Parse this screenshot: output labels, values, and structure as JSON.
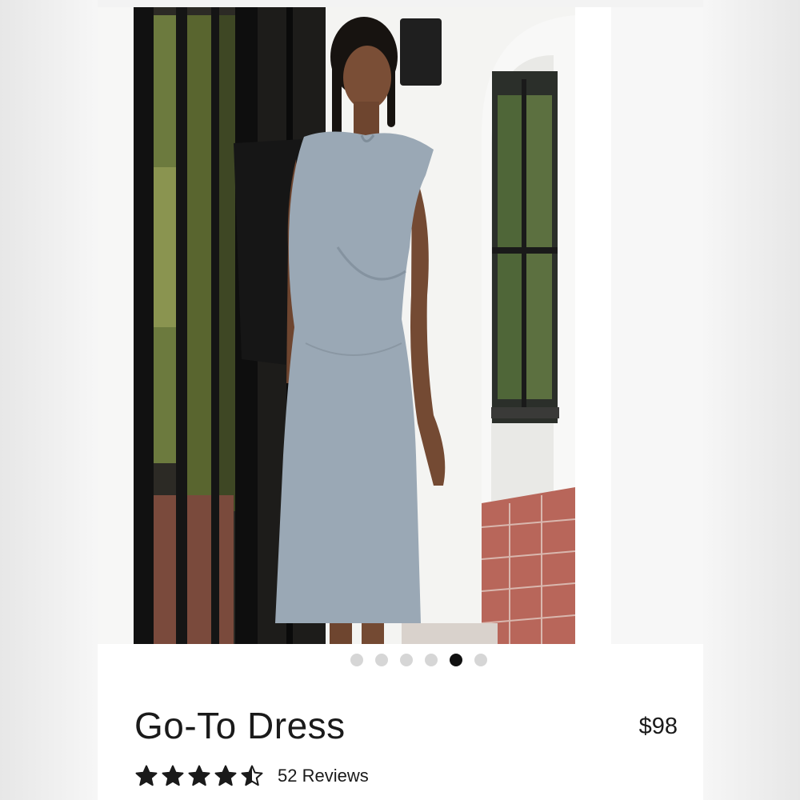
{
  "product": {
    "name": "Go-To Dress",
    "price": "$98",
    "rating": 4.5,
    "reviews_label": "52 Reviews",
    "image_label": "Model wearing a grey sleeveless midi dress",
    "dress_color": "#9aa8b5"
  },
  "carousel": {
    "total": 6,
    "active_index": 4
  },
  "icons": {
    "star_full": "star-icon",
    "star_half": "star-half-icon"
  }
}
